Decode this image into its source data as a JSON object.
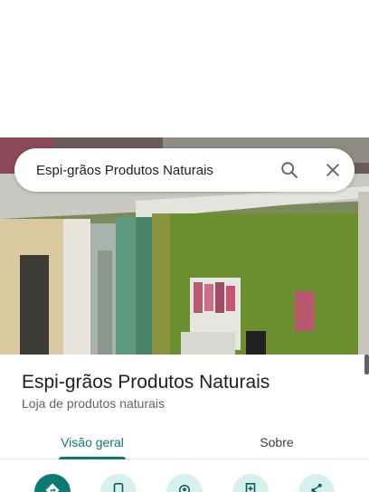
{
  "search": {
    "query": "Espi-grãos Produtos Naturais",
    "search_icon": "search-icon",
    "close_icon": "close-icon"
  },
  "place": {
    "name": "Espi-grãos Produtos Naturais",
    "category": "Loja de produtos naturais"
  },
  "tabs": [
    {
      "label": "Visão geral",
      "active": true
    },
    {
      "label": "Sobre",
      "active": false
    }
  ],
  "actions": [
    {
      "icon": "directions-icon",
      "primary": true
    },
    {
      "icon": "phone-icon",
      "primary": false
    },
    {
      "icon": "nearby-icon",
      "primary": false
    },
    {
      "icon": "save-icon",
      "primary": false
    },
    {
      "icon": "share-icon",
      "primary": false
    }
  ],
  "colors": {
    "accent": "#0b7a75",
    "action_bg": "#d6f0ee"
  }
}
